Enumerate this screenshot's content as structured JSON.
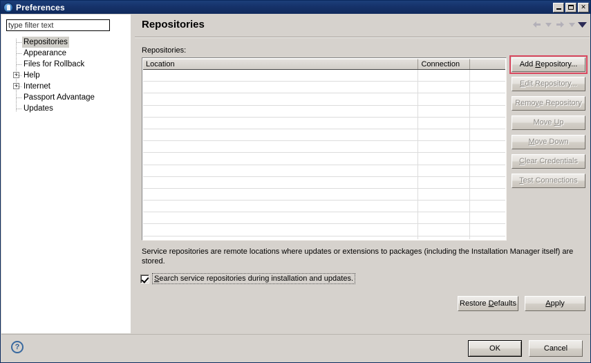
{
  "window": {
    "title": "Preferences",
    "icon": "preferences-app-icon",
    "controls": {
      "minimize": "minimize-icon",
      "maximize": "maximize-icon",
      "close": "✕"
    }
  },
  "sidebar": {
    "filter": {
      "value": "type filter text",
      "placeholder": "type filter text"
    },
    "items": [
      {
        "label": "Repositories",
        "selected": true,
        "expandable": false
      },
      {
        "label": "Appearance",
        "selected": false,
        "expandable": false
      },
      {
        "label": "Files for Rollback",
        "selected": false,
        "expandable": false
      },
      {
        "label": "Help",
        "selected": false,
        "expandable": true,
        "toggle": "+"
      },
      {
        "label": "Internet",
        "selected": false,
        "expandable": true,
        "toggle": "+"
      },
      {
        "label": "Passport Advantage",
        "selected": false,
        "expandable": false
      },
      {
        "label": "Updates",
        "selected": false,
        "expandable": false
      }
    ]
  },
  "page": {
    "title": "Repositories",
    "nav": {
      "back": "back-arrow-icon",
      "back_menu": "back-history-chevron-icon",
      "forward": "forward-arrow-icon",
      "forward_menu": "forward-history-chevron-icon",
      "menu": "view-menu-chevron-icon"
    },
    "table_label": "Repositories:",
    "table": {
      "columns": [
        "Location",
        "Connection",
        ""
      ],
      "rows": [],
      "empty_row_count": 15
    },
    "side_buttons": [
      {
        "label": "Add Repository...",
        "mnemonic": "R",
        "enabled": true,
        "focused": true
      },
      {
        "label": "Edit Repository...",
        "mnemonic": "E",
        "enabled": false,
        "focused": false
      },
      {
        "label": "Remove Repository",
        "mnemonic": "v",
        "enabled": false,
        "focused": false
      },
      {
        "label": "Move Up",
        "mnemonic": "U",
        "enabled": false,
        "focused": false
      },
      {
        "label": "Move Down",
        "mnemonic": "M",
        "enabled": false,
        "focused": false
      },
      {
        "label": "Clear Credentials",
        "mnemonic": "C",
        "enabled": false,
        "focused": false
      },
      {
        "label": "Test Connections",
        "mnemonic": "T",
        "enabled": false,
        "focused": false
      }
    ],
    "description": "Service repositories are remote locations where updates or extensions to packages (including the Installation Manager itself) are stored.",
    "checkbox": {
      "label": "Search service repositories during installation and updates.",
      "mnemonic": "S",
      "checked": true
    },
    "restore_defaults_label": "Restore Defaults",
    "restore_defaults_mnemonic": "D",
    "apply_label": "Apply",
    "apply_mnemonic": "A"
  },
  "footer": {
    "help": "?",
    "ok_label": "OK",
    "cancel_label": "Cancel"
  },
  "colors": {
    "titlebar": "#16326a",
    "dialog_background": "#d6d2cd",
    "focus_highlight": "#d9485f",
    "field_background": "#ffffff"
  }
}
